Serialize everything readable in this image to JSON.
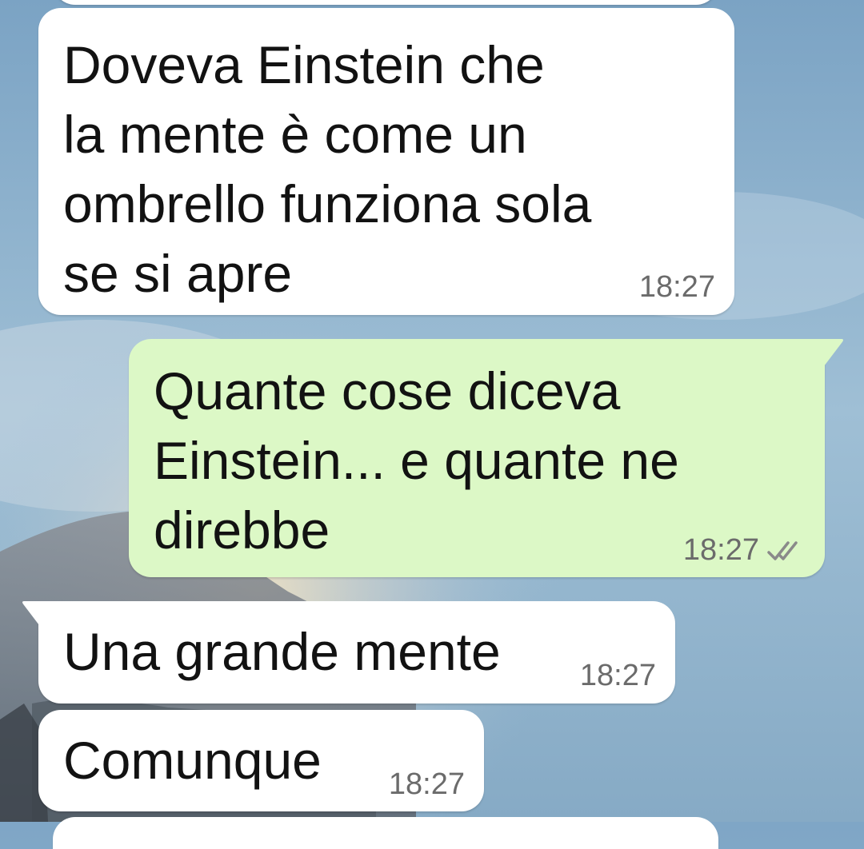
{
  "chat": {
    "messages": [
      {
        "direction": "incoming",
        "text": "Doveva Einstein che\nla mente è come un\nombrello funziona sola\nse si apre",
        "time": "18:27"
      },
      {
        "direction": "outgoing",
        "text": "Quante cose diceva\nEinstein... e quante ne\ndirebbe",
        "time": "18:27",
        "status_icon": "double-check-icon"
      },
      {
        "direction": "incoming",
        "text": "Una grande mente",
        "time": "18:27"
      },
      {
        "direction": "incoming",
        "text": "Comunque",
        "time": "18:27"
      }
    ]
  },
  "colors": {
    "incoming_bubble": "#ffffff",
    "outgoing_bubble": "#dcf8c6",
    "timestamp": "#6b6b6b",
    "read_ticks": "#8a8a8a"
  }
}
